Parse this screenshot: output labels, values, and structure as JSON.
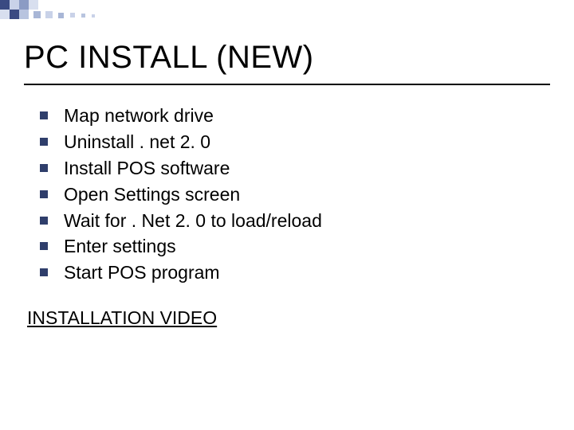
{
  "title": "PC INSTALL (NEW)",
  "bullets": [
    "Map network drive",
    "Uninstall . net 2. 0",
    "Install POS software",
    "Open Settings screen",
    "Wait for . Net 2. 0 to load/reload",
    "Enter settings",
    "Start POS program"
  ],
  "link_label": "INSTALLATION VIDEO"
}
